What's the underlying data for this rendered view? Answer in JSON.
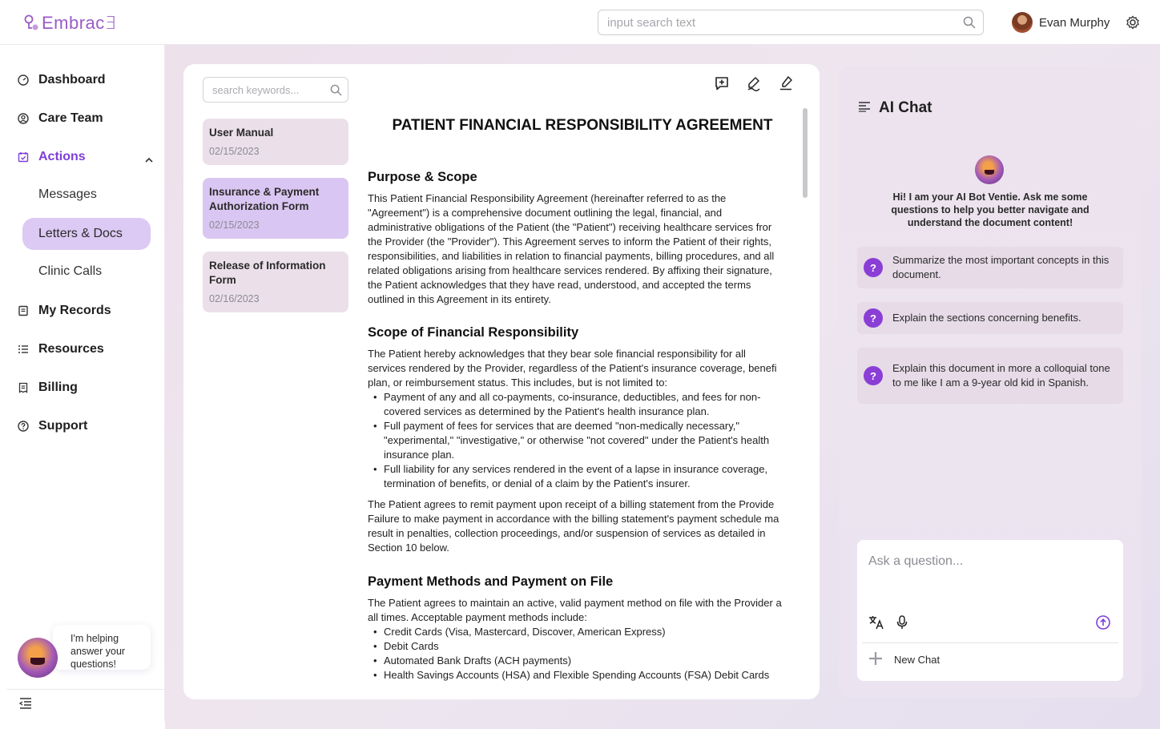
{
  "app": {
    "logo_text": "Embrac∃",
    "search_placeholder": "input search text",
    "user_name": "Evan Murphy"
  },
  "sidebar": {
    "items": [
      {
        "label": "Dashboard",
        "icon": "dashboard-icon"
      },
      {
        "label": "Care Team",
        "icon": "user-circle-icon"
      },
      {
        "label": "Actions",
        "icon": "calendar-check-icon"
      },
      {
        "label": "My Records",
        "icon": "records-icon"
      },
      {
        "label": "Resources",
        "icon": "list-icon"
      },
      {
        "label": "Billing",
        "icon": "receipt-icon"
      },
      {
        "label": "Support",
        "icon": "help-icon"
      }
    ],
    "sub_items": [
      "Messages",
      "Letters & Docs",
      "Clinic Calls"
    ],
    "selected_sub": "Letters & Docs",
    "helper_text": "I'm helping answer your questions!"
  },
  "documents": {
    "search_placeholder": "search keywords...",
    "list": [
      {
        "title": "User Manual",
        "date": "02/15/2023"
      },
      {
        "title": "Insurance & Payment Authorization Form",
        "date": "02/15/2023"
      },
      {
        "title": "Release of Information Form",
        "date": "02/16/2023"
      }
    ],
    "viewer": {
      "title": "PATIENT FINANCIAL RESPONSIBILITY AGREEMENT",
      "s1_heading": "Purpose & Scope",
      "s1_lines": [
        "This Patient Financial Responsibility Agreement (hereinafter referred to as the",
        "\"Agreement\") is a comprehensive document outlining the legal, financial, and",
        "administrative obligations of the Patient (the \"Patient\") receiving healthcare services fror",
        "the Provider (the \"Provider\"). This Agreement serves to inform the Patient of their rights,",
        "responsibilities, and liabilities in relation to financial payments, billing procedures, and all",
        "related obligations arising from healthcare services rendered. By affixing their signature,",
        "the Patient acknowledges that they have read, understood, and accepted the terms",
        "outlined in this Agreement in its entirety."
      ],
      "s2_heading": "Scope of Financial Responsibility",
      "s2_intro": [
        "The Patient hereby acknowledges that they bear sole financial responsibility for all",
        "services rendered by the Provider, regardless of the Patient's insurance coverage, benefi",
        "plan, or reimbursement status. This includes, but is not limited to:"
      ],
      "s2_bullets": [
        [
          "Payment of any and all co-payments, co-insurance, deductibles, and fees for non-",
          "covered services as determined by the Patient's health insurance plan."
        ],
        [
          "Full payment of fees for services that are deemed \"non-medically necessary,\"",
          "\"experimental,\" \"investigative,\" or otherwise \"not covered\" under the Patient's health",
          "insurance plan."
        ],
        [
          "Full liability for any services rendered in the event of a lapse in insurance coverage,",
          "termination of benefits, or denial of a claim by the Patient's insurer."
        ]
      ],
      "s2_outro": [
        "The Patient agrees to remit payment upon receipt of a billing statement from the Provide",
        "Failure to make payment in accordance with the billing statement's payment schedule ma",
        "result in penalties, collection proceedings, and/or suspension of services as detailed in",
        "Section 10 below."
      ],
      "s3_heading": "Payment Methods and Payment on File",
      "s3_intro": [
        "The Patient agrees to maintain an active, valid payment method on file with the Provider a",
        "all times. Acceptable payment methods include:"
      ],
      "s3_bullets": [
        "Credit Cards (Visa, Mastercard, Discover, American Express)",
        "Debit Cards",
        "Automated Bank Drafts (ACH payments)",
        "Health Savings Accounts (HSA) and Flexible Spending Accounts (FSA) Debit Cards"
      ]
    }
  },
  "chat": {
    "title": "AI Chat",
    "intro": "Hi! I am your AI Bot Ventie. Ask me some questions to help you better navigate and understand the document content!",
    "suggestions": [
      "Summarize the most important concepts in this document.",
      "Explain the sections concerning benefits.",
      "Explain this document in more a colloquial tone to me like I am a  9-year old kid in Spanish."
    ],
    "input_placeholder": "Ask a question...",
    "new_chat_label": "New Chat"
  },
  "colors": {
    "accent": "#7e3fd6",
    "selected_bg": "#dcc9f4",
    "card_bg": "#ebe0ea",
    "question_badge": "#8a3ed6"
  }
}
